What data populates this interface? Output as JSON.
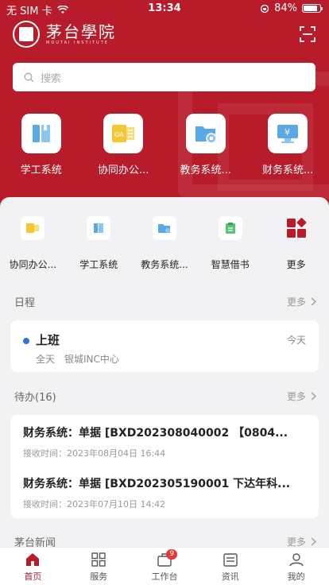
{
  "status_bar": {
    "carrier": "无 SIM 卡",
    "time": "13:34",
    "battery_text": "84%",
    "battery_level": 0.84
  },
  "header": {
    "school_name": "茅台學院",
    "school_name_en": "MOUTAI INSTITUTE"
  },
  "search": {
    "placeholder": "搜索"
  },
  "hero_apps": [
    {
      "label": "学工系统",
      "icon": "book-icon"
    },
    {
      "label": "协同办公...",
      "icon": "oa-icon"
    },
    {
      "label": "教务系统...",
      "icon": "folder-icon"
    },
    {
      "label": "财务系统...",
      "icon": "finance-icon"
    }
  ],
  "quick_apps": [
    {
      "label": "协同办公...",
      "icon": "oa-icon"
    },
    {
      "label": "学工系统",
      "icon": "book-icon"
    },
    {
      "label": "教务系统...",
      "icon": "folder-icon"
    },
    {
      "label": "智慧借书",
      "icon": "clipboard-icon"
    },
    {
      "label": "更多",
      "icon": "more-apps-icon"
    }
  ],
  "schedule": {
    "title": "日程",
    "more": "更多",
    "item": {
      "title": "上班",
      "date": "今天",
      "duration": "全天",
      "location": "银城INC中心"
    }
  },
  "todo": {
    "title": "待办(16)",
    "more": "更多",
    "items": [
      {
        "title": "财务系统：单据 [BXD202308040002 【0804...",
        "time": "接收时间：2023年08月04日 16:44"
      },
      {
        "title": "财务系统：单据 [BXD202305190001 下达年科...",
        "time": "接收时间：2023年07月10日 14:42"
      }
    ]
  },
  "news": {
    "title": "茅台新闻",
    "more": "更多"
  },
  "tabbar": [
    {
      "label": "首页",
      "active": true
    },
    {
      "label": "服务",
      "active": false
    },
    {
      "label": "工作台",
      "active": false,
      "badge": "9"
    },
    {
      "label": "资讯",
      "active": false
    },
    {
      "label": "我的",
      "active": false
    }
  ],
  "colors": {
    "brand": "#b81c2b",
    "accent_blue": "#2f72e0"
  }
}
